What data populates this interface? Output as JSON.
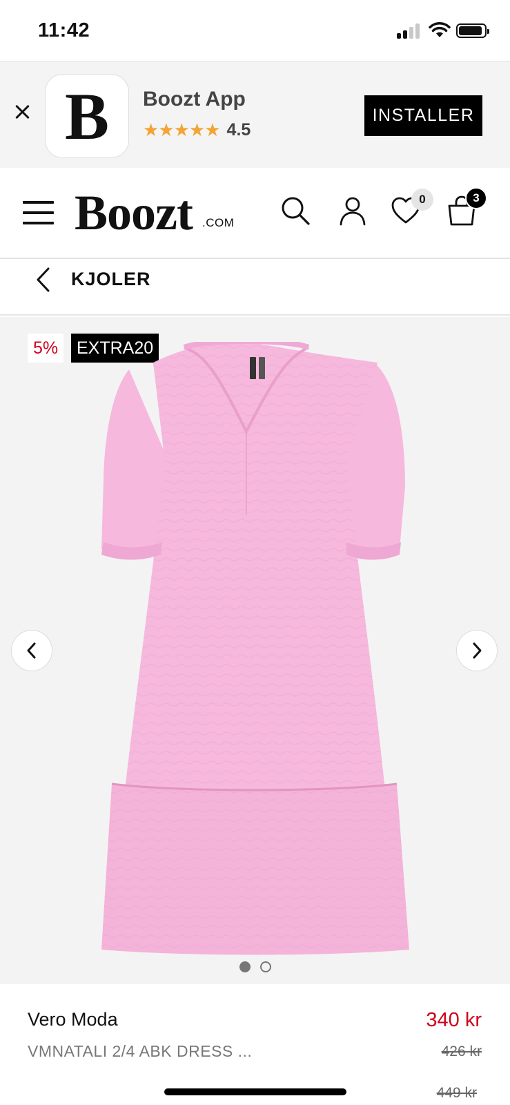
{
  "status_bar": {
    "time": "11:42"
  },
  "app_banner": {
    "app_name": "Boozt App",
    "rating": "4.5",
    "stars": "★★★★★",
    "install_label": "INSTALLER",
    "app_icon_letter": "B"
  },
  "header": {
    "logo_text": "Boozt",
    "logo_suffix": ".COM",
    "wishlist_count": "0",
    "cart_count": "3"
  },
  "breadcrumb": {
    "label": "KJOLER"
  },
  "product": {
    "tags": {
      "discount": "5%",
      "code": "EXTRA20"
    },
    "brand": "Vero Moda",
    "name": "VMNATALI 2/4 ABK DRESS ...",
    "price": "340 kr",
    "old_price": "426 kr",
    "original_price": "449 kr",
    "image_count": 2,
    "active_image": 1
  },
  "colors": {
    "accent_red": "#d0021b",
    "star_orange": "#f2a533",
    "dress_pink": "#f6b8dd"
  }
}
